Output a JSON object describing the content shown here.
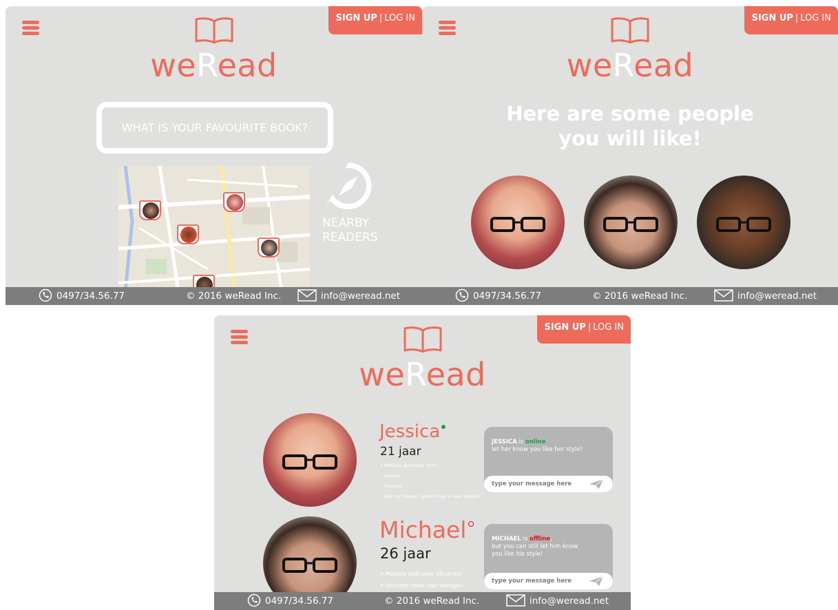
{
  "brand": {
    "prefix": "we",
    "emph": "R",
    "suffix": "ead",
    "accent": "#ee6a5b",
    "panel_bg": "#e0e0df",
    "footer_bg": "#7d7d7d"
  },
  "auth": {
    "signup": "SIGN UP",
    "sep": "|",
    "login": "LOG IN"
  },
  "footer": {
    "phone": "0497/34.56.77",
    "copyright": "© 2016 weRead Inc.",
    "email": "info@weread.net"
  },
  "screen1": {
    "search_placeholder": "WHAT IS YOUR FAVOURITE BOOK?",
    "nearby_line1": "NEARBY",
    "nearby_line2": "READERS"
  },
  "screen2": {
    "headline_line1": "Here are some people",
    "headline_line2": "you will like!"
  },
  "screen3": {
    "profiles": [
      {
        "name": "Jessica",
        "age": "21 jaar",
        "status_name": "JESSICA",
        "status_is": " is ",
        "status_word": "online",
        "status_tail": "",
        "status_sub": "let her know you like her style!",
        "traits": [
          "Mobiele gebruiker (iOS)",
          "Sociaal",
          "Feesjaar",
          "Gek op boeken, gezelschap en een babbel"
        ],
        "message_placeholder": "type your message here"
      },
      {
        "name": "Michael",
        "age": "26 jaar",
        "status_name": "MICHAEL",
        "status_is": " is ",
        "status_word": "offline",
        "status_tail": ",",
        "status_sub1": "but you can still let him know",
        "status_sub2": "you like his style!",
        "traits": [
          "Mobiele gebruiker (Android)",
          "Introvert maar niet verlegen"
        ],
        "message_placeholder": "type your message here"
      }
    ]
  }
}
